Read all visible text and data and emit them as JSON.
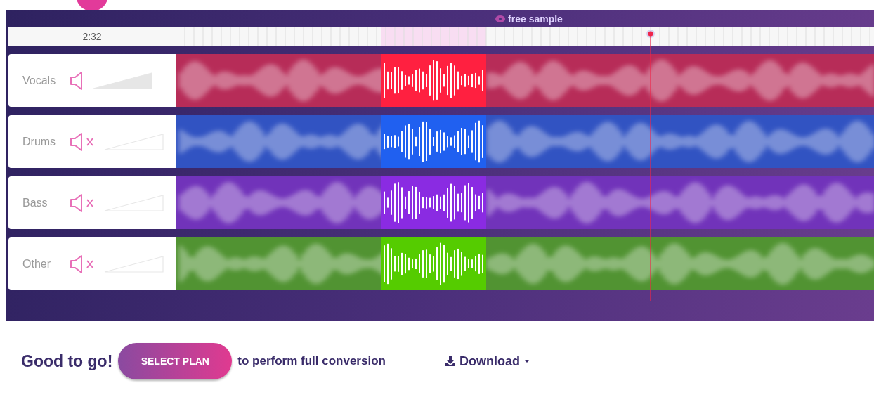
{
  "timeline": {
    "time": "2:32",
    "sample_label": "free sample"
  },
  "tracks": [
    {
      "name": "Vocals",
      "muted": false,
      "color": "#ff2040"
    },
    {
      "name": "Drums",
      "muted": true,
      "color": "#2060f0"
    },
    {
      "name": "Bass",
      "muted": true,
      "color": "#8a2be2"
    },
    {
      "name": "Other",
      "muted": true,
      "color": "#55cc00"
    }
  ],
  "footer": {
    "title": "Good to go!",
    "button": "SELECT PLAN",
    "text": "to perform full conversion",
    "download": "Download"
  }
}
